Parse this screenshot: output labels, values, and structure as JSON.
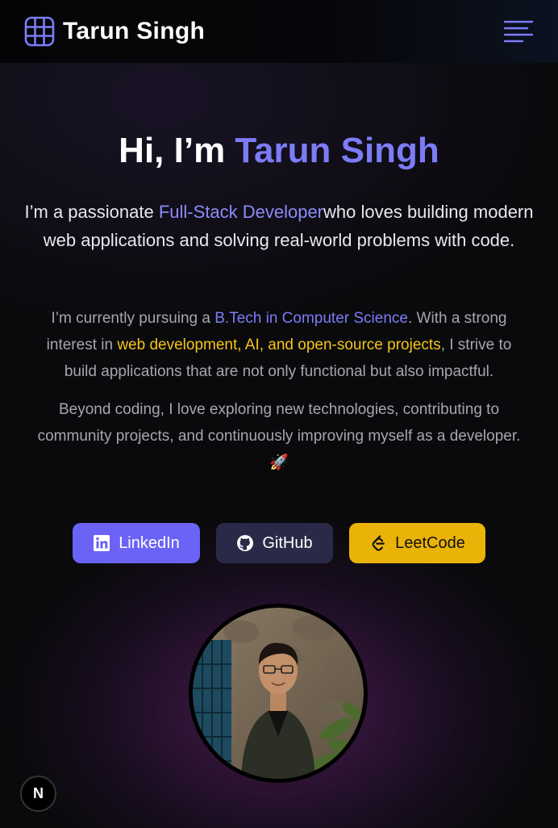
{
  "nav": {
    "brand_name": "Tarun Singh",
    "brand_icon": "grid-icon",
    "menu_icon": "hamburger-menu-icon"
  },
  "hero": {
    "greeting_prefix": "Hi, I’m ",
    "greeting_name": "Tarun Singh",
    "intro_prefix": "I’m a passionate ",
    "intro_highlight": "Full-Stack Developer",
    "intro_suffix": "who loves building modern web applications and solving real-world problems with code.",
    "para1_prefix": "I’m currently pursuing a ",
    "para1_highlight": "B.Tech in Computer Science",
    "para1_mid": ". With a strong interest in ",
    "para1_highlight2": "web development, AI, and open-source projects",
    "para1_suffix": ", I strive to build applications that are not only functional but also impactful.",
    "para2": "Beyond coding, I love exploring new technologies, contributing to community projects, and continuously improving myself as a developer. 🚀"
  },
  "socials": {
    "linkedin": "LinkedIn",
    "github": "GitHub",
    "leetcode": "LeetCode"
  },
  "badge": {
    "letter": "N"
  },
  "colors": {
    "accent": "#7c7cf7",
    "linkedin_bg": "#6b63f5",
    "github_bg": "#2a2a48",
    "leetcode_bg": "#eab308",
    "highlight_yellow": "#f5c518"
  }
}
